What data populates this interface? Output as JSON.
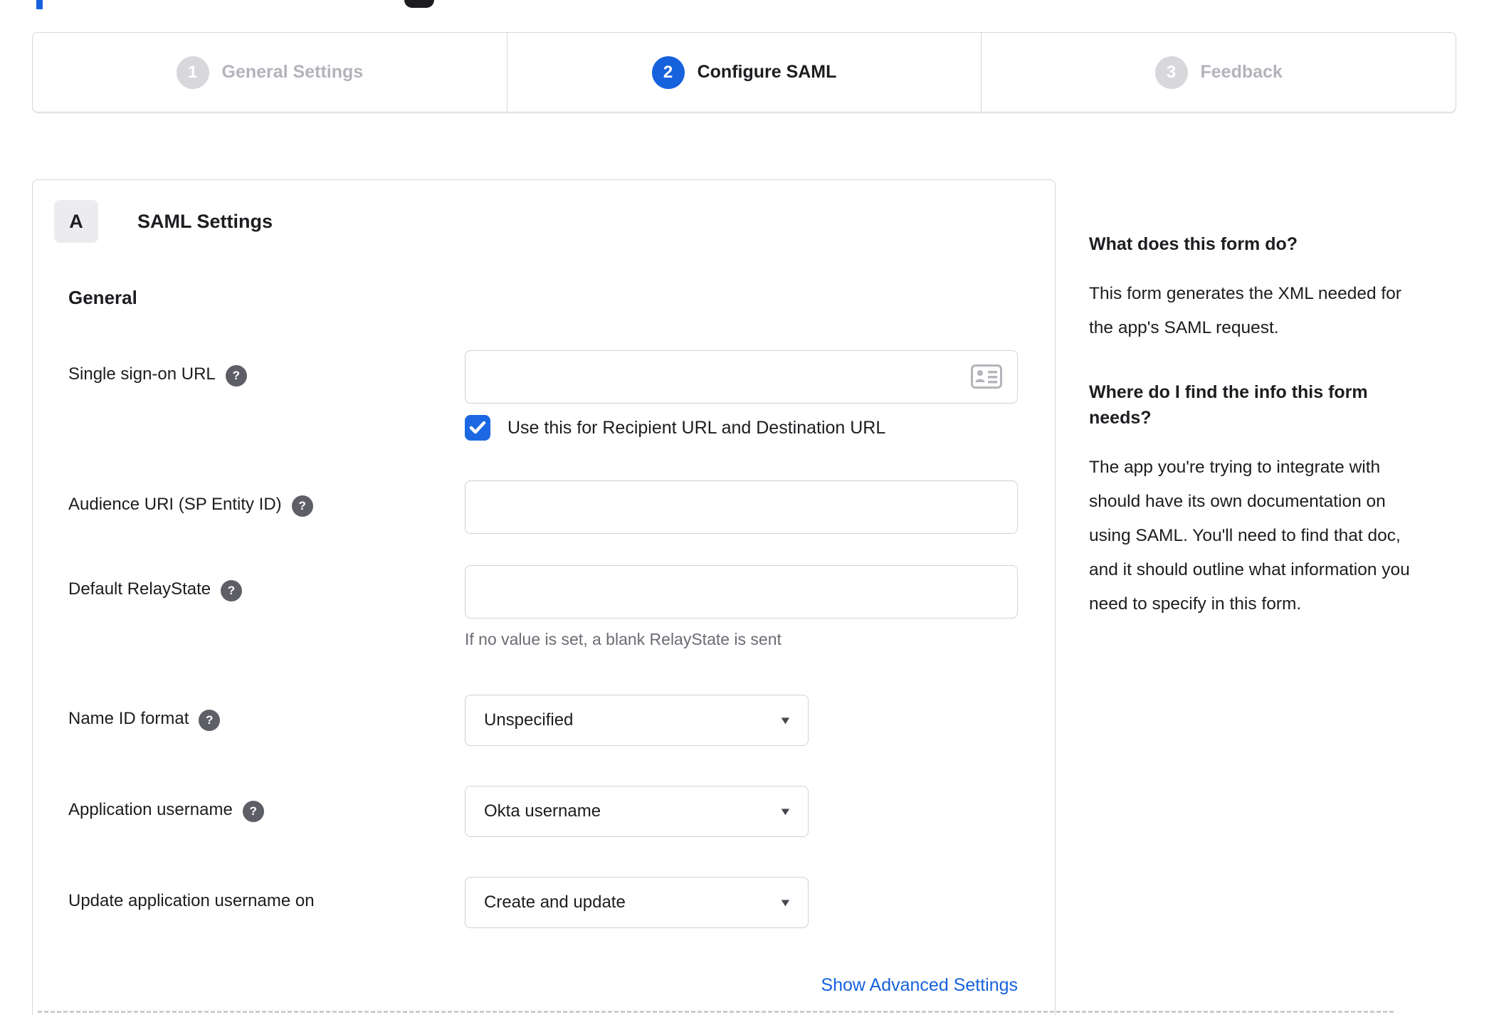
{
  "stepper": {
    "steps": [
      {
        "number": "1",
        "label": "General Settings",
        "state": "inactive"
      },
      {
        "number": "2",
        "label": "Configure SAML",
        "state": "active"
      },
      {
        "number": "3",
        "label": "Feedback",
        "state": "inactive"
      }
    ]
  },
  "panel": {
    "badge": "A",
    "title": "SAML Settings",
    "section": "General",
    "fields": {
      "sso": {
        "label": "Single sign-on URL",
        "value": "",
        "checkbox_label": "Use this for Recipient URL and Destination URL",
        "checkbox_checked": true
      },
      "audience": {
        "label": "Audience URI (SP Entity ID)",
        "value": ""
      },
      "relay": {
        "label": "Default RelayState",
        "value": "",
        "hint": "If no value is set, a blank RelayState is sent"
      },
      "nameid": {
        "label": "Name ID format",
        "value": "Unspecified"
      },
      "appuser": {
        "label": "Application username",
        "value": "Okta username"
      },
      "update": {
        "label": "Update application username on",
        "value": "Create and update"
      }
    },
    "advanced_link": "Show Advanced Settings"
  },
  "sidebar": {
    "sections": [
      {
        "heading": "What does this form do?",
        "body": "This form generates the XML needed for the app's SAML request."
      },
      {
        "heading": "Where do I find the info this form needs?",
        "body": "The app you're trying to integrate with should have its own documentation on using SAML. You'll need to find that doc, and it should outline what information you need to specify in this form."
      }
    ]
  },
  "icons": {
    "help": "?",
    "caret": "▼"
  },
  "colors": {
    "accent_blue": "#1662dd",
    "link_blue": "#1662dd",
    "inactive_gray": "#d7d7dc"
  }
}
